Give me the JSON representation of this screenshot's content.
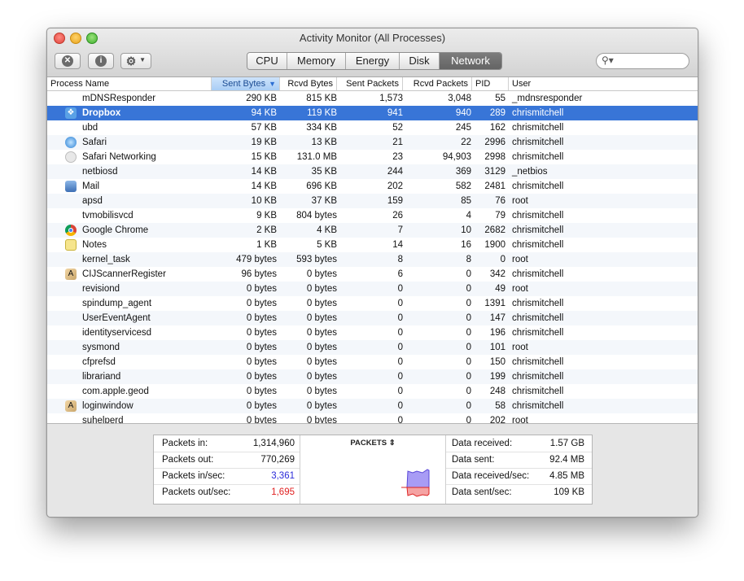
{
  "window": {
    "title": "Activity Monitor (All Processes)"
  },
  "toolbar": {
    "tabs": [
      {
        "label": "CPU",
        "active": false
      },
      {
        "label": "Memory",
        "active": false
      },
      {
        "label": "Energy",
        "active": false
      },
      {
        "label": "Disk",
        "active": false
      },
      {
        "label": "Network",
        "active": true
      }
    ],
    "search": {
      "placeholder": ""
    },
    "icons": {
      "stop": "stop-process-icon",
      "info": "inspect-icon",
      "action": "gear-icon"
    }
  },
  "table": {
    "columns": [
      {
        "label": "Process Name"
      },
      {
        "label": "Sent Bytes",
        "sorted": true
      },
      {
        "label": "Rcvd Bytes"
      },
      {
        "label": "Sent Packets"
      },
      {
        "label": "Rcvd Packets"
      },
      {
        "label": "PID"
      },
      {
        "label": "User"
      }
    ],
    "rows": [
      {
        "name": "mDNSResponder",
        "icon": "",
        "sent_bytes": "290 KB",
        "rcvd_bytes": "815 KB",
        "sent_packets": "1,573",
        "rcvd_packets": "3,048",
        "pid": "55",
        "user": "_mdnsresponder"
      },
      {
        "name": "Dropbox",
        "icon": "dropbox-icon",
        "sent_bytes": "94 KB",
        "rcvd_bytes": "119 KB",
        "sent_packets": "941",
        "rcvd_packets": "940",
        "pid": "289",
        "user": "chrismitchell",
        "selected": true
      },
      {
        "name": "ubd",
        "icon": "",
        "sent_bytes": "57 KB",
        "rcvd_bytes": "334 KB",
        "sent_packets": "52",
        "rcvd_packets": "245",
        "pid": "162",
        "user": "chrismitchell"
      },
      {
        "name": "Safari",
        "icon": "safari-icon",
        "sent_bytes": "19 KB",
        "rcvd_bytes": "13 KB",
        "sent_packets": "21",
        "rcvd_packets": "22",
        "pid": "2996",
        "user": "chrismitchell"
      },
      {
        "name": "Safari Networking",
        "icon": "safari-networking-icon",
        "sent_bytes": "15 KB",
        "rcvd_bytes": "131.0 MB",
        "sent_packets": "23",
        "rcvd_packets": "94,903",
        "pid": "2998",
        "user": "chrismitchell"
      },
      {
        "name": "netbiosd",
        "icon": "",
        "sent_bytes": "14 KB",
        "rcvd_bytes": "35 KB",
        "sent_packets": "244",
        "rcvd_packets": "369",
        "pid": "3129",
        "user": "_netbios"
      },
      {
        "name": "Mail",
        "icon": "mail-icon",
        "sent_bytes": "14 KB",
        "rcvd_bytes": "696 KB",
        "sent_packets": "202",
        "rcvd_packets": "582",
        "pid": "2481",
        "user": "chrismitchell"
      },
      {
        "name": "apsd",
        "icon": "",
        "sent_bytes": "10 KB",
        "rcvd_bytes": "37 KB",
        "sent_packets": "159",
        "rcvd_packets": "85",
        "pid": "76",
        "user": "root"
      },
      {
        "name": "tvmobilisvcd",
        "icon": "",
        "sent_bytes": "9 KB",
        "rcvd_bytes": "804 bytes",
        "sent_packets": "26",
        "rcvd_packets": "4",
        "pid": "79",
        "user": "chrismitchell"
      },
      {
        "name": "Google Chrome",
        "icon": "chrome-icon",
        "sent_bytes": "2 KB",
        "rcvd_bytes": "4 KB",
        "sent_packets": "7",
        "rcvd_packets": "10",
        "pid": "2682",
        "user": "chrismitchell"
      },
      {
        "name": "Notes",
        "icon": "notes-icon",
        "sent_bytes": "1 KB",
        "rcvd_bytes": "5 KB",
        "sent_packets": "14",
        "rcvd_packets": "16",
        "pid": "1900",
        "user": "chrismitchell"
      },
      {
        "name": "kernel_task",
        "icon": "",
        "sent_bytes": "479 bytes",
        "rcvd_bytes": "593 bytes",
        "sent_packets": "8",
        "rcvd_packets": "8",
        "pid": "0",
        "user": "root"
      },
      {
        "name": "CIJScannerRegister",
        "icon": "app-icon",
        "sent_bytes": "96 bytes",
        "rcvd_bytes": "0 bytes",
        "sent_packets": "6",
        "rcvd_packets": "0",
        "pid": "342",
        "user": "chrismitchell"
      },
      {
        "name": "revisiond",
        "icon": "",
        "sent_bytes": "0 bytes",
        "rcvd_bytes": "0 bytes",
        "sent_packets": "0",
        "rcvd_packets": "0",
        "pid": "49",
        "user": "root"
      },
      {
        "name": "spindump_agent",
        "icon": "",
        "sent_bytes": "0 bytes",
        "rcvd_bytes": "0 bytes",
        "sent_packets": "0",
        "rcvd_packets": "0",
        "pid": "1391",
        "user": "chrismitchell"
      },
      {
        "name": "UserEventAgent",
        "icon": "",
        "sent_bytes": "0 bytes",
        "rcvd_bytes": "0 bytes",
        "sent_packets": "0",
        "rcvd_packets": "0",
        "pid": "147",
        "user": "chrismitchell"
      },
      {
        "name": "identityservicesd",
        "icon": "",
        "sent_bytes": "0 bytes",
        "rcvd_bytes": "0 bytes",
        "sent_packets": "0",
        "rcvd_packets": "0",
        "pid": "196",
        "user": "chrismitchell"
      },
      {
        "name": "sysmond",
        "icon": "",
        "sent_bytes": "0 bytes",
        "rcvd_bytes": "0 bytes",
        "sent_packets": "0",
        "rcvd_packets": "0",
        "pid": "101",
        "user": "root"
      },
      {
        "name": "cfprefsd",
        "icon": "",
        "sent_bytes": "0 bytes",
        "rcvd_bytes": "0 bytes",
        "sent_packets": "0",
        "rcvd_packets": "0",
        "pid": "150",
        "user": "chrismitchell"
      },
      {
        "name": "librariand",
        "icon": "",
        "sent_bytes": "0 bytes",
        "rcvd_bytes": "0 bytes",
        "sent_packets": "0",
        "rcvd_packets": "0",
        "pid": "199",
        "user": "chrismitchell"
      },
      {
        "name": "com.apple.geod",
        "icon": "",
        "sent_bytes": "0 bytes",
        "rcvd_bytes": "0 bytes",
        "sent_packets": "0",
        "rcvd_packets": "0",
        "pid": "248",
        "user": "chrismitchell"
      },
      {
        "name": "loginwindow",
        "icon": "app-icon",
        "sent_bytes": "0 bytes",
        "rcvd_bytes": "0 bytes",
        "sent_packets": "0",
        "rcvd_packets": "0",
        "pid": "58",
        "user": "chrismitchell"
      },
      {
        "name": "suhelperd",
        "icon": "",
        "sent_bytes": "0 bytes",
        "rcvd_bytes": "0 bytes",
        "sent_packets": "0",
        "rcvd_packets": "0",
        "pid": "202",
        "user": "root"
      }
    ]
  },
  "summary": {
    "left": [
      {
        "label": "Packets in:",
        "value": "1,314,960",
        "color": "#111111"
      },
      {
        "label": "Packets out:",
        "value": "770,269",
        "color": "#111111"
      },
      {
        "label": "Packets in/sec:",
        "value": "3,361",
        "color": "#2b2bd9"
      },
      {
        "label": "Packets out/sec:",
        "value": "1,695",
        "color": "#e02020"
      }
    ],
    "chart_title": "PACKETS",
    "right": [
      {
        "label": "Data received:",
        "value": "1.57 GB"
      },
      {
        "label": "Data sent:",
        "value": "92.4 MB"
      },
      {
        "label": "Data received/sec:",
        "value": "4.85 MB"
      },
      {
        "label": "Data sent/sec:",
        "value": "109 KB"
      }
    ]
  },
  "colors": {
    "selection": "#3875d7",
    "packets_in": "#8a7cf0",
    "packets_out": "#f08a8a"
  }
}
